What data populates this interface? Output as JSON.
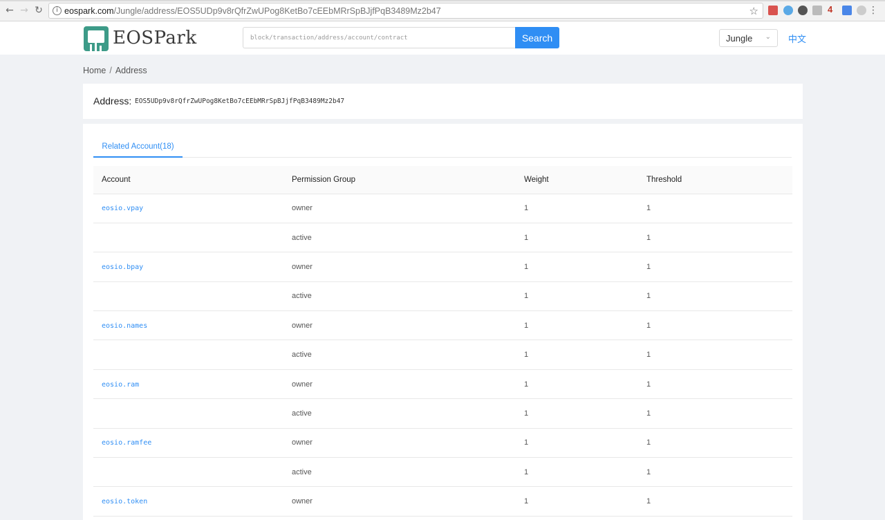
{
  "browser": {
    "url_host": "eospark.com",
    "url_path": "/Jungle/address/EOS5UDp9v8rQfrZwUPog8KetBo7cEEbMRrSpBJjfPqB3489Mz2b47",
    "ext_badge": "4"
  },
  "header": {
    "logo_text": "EOSPark",
    "search_placeholder": "block/transaction/address/account/contract",
    "search_button": "Search",
    "network": "Jungle",
    "language_link": "中文"
  },
  "breadcrumb": {
    "home": "Home",
    "separator": "/",
    "current": "Address"
  },
  "address": {
    "label": "Address:",
    "value": "EOS5UDp9v8rQfrZwUPog8KetBo7cEEbMRrSpBJjfPqB3489Mz2b47"
  },
  "tabs": [
    {
      "label": "Related Account(18)"
    }
  ],
  "table": {
    "headers": [
      "Account",
      "Permission Group",
      "Weight",
      "Threshold"
    ],
    "rows": [
      {
        "account": "eosio.vpay",
        "permission": "owner",
        "weight": "1",
        "threshold": "1"
      },
      {
        "account": "",
        "permission": "active",
        "weight": "1",
        "threshold": "1"
      },
      {
        "account": "eosio.bpay",
        "permission": "owner",
        "weight": "1",
        "threshold": "1"
      },
      {
        "account": "",
        "permission": "active",
        "weight": "1",
        "threshold": "1"
      },
      {
        "account": "eosio.names",
        "permission": "owner",
        "weight": "1",
        "threshold": "1"
      },
      {
        "account": "",
        "permission": "active",
        "weight": "1",
        "threshold": "1"
      },
      {
        "account": "eosio.ram",
        "permission": "owner",
        "weight": "1",
        "threshold": "1"
      },
      {
        "account": "",
        "permission": "active",
        "weight": "1",
        "threshold": "1"
      },
      {
        "account": "eosio.ramfee",
        "permission": "owner",
        "weight": "1",
        "threshold": "1"
      },
      {
        "account": "",
        "permission": "active",
        "weight": "1",
        "threshold": "1"
      },
      {
        "account": "eosio.token",
        "permission": "owner",
        "weight": "1",
        "threshold": "1"
      }
    ]
  },
  "colors": {
    "accent": "#2f8ef4",
    "logo_green": "#3d9b88",
    "page_bg": "#f0f2f5"
  }
}
